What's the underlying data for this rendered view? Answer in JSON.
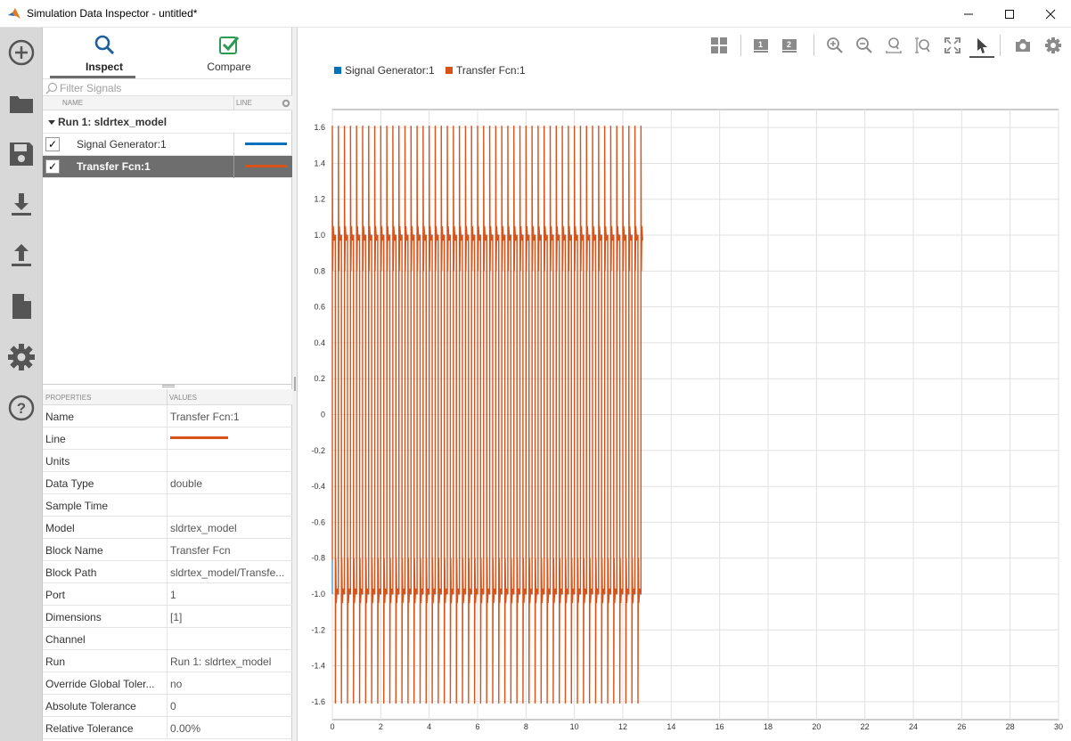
{
  "window": {
    "title": "Simulation Data Inspector - untitled*",
    "minimize": "—",
    "maximize": "☐",
    "close": "✕"
  },
  "rail": {
    "items": [
      "new-session",
      "open-folder",
      "save",
      "import",
      "export",
      "report",
      "settings",
      "help"
    ]
  },
  "tabs": {
    "inspect": "Inspect",
    "compare": "Compare"
  },
  "filter": {
    "placeholder": "Filter Signals"
  },
  "columns": {
    "name": "NAME",
    "line": "LINE"
  },
  "run": {
    "label": "Run 1: sldrtex_model"
  },
  "signals": [
    {
      "name": "Signal Generator:1",
      "checked": "✓",
      "color": "#0072bd",
      "selected": false
    },
    {
      "name": "Transfer Fcn:1",
      "checked": "✓",
      "color": "#d95319",
      "selected": true
    }
  ],
  "properties_header": {
    "key": "PROPERTIES",
    "value": "VALUES"
  },
  "properties": [
    {
      "key": "Name",
      "value": "Transfer Fcn:1"
    },
    {
      "key": "Line",
      "value": ""
    },
    {
      "key": "Units",
      "value": ""
    },
    {
      "key": "Data Type",
      "value": "double"
    },
    {
      "key": "Sample Time",
      "value": ""
    },
    {
      "key": "Model",
      "value": "sldrtex_model"
    },
    {
      "key": "Block Name",
      "value": "Transfer Fcn"
    },
    {
      "key": "Block Path",
      "value": "sldrtex_model/Transfe..."
    },
    {
      "key": "Port",
      "value": "1"
    },
    {
      "key": "Dimensions",
      "value": "[1]"
    },
    {
      "key": "Channel",
      "value": ""
    },
    {
      "key": "Run",
      "value": "Run 1: sldrtex_model"
    },
    {
      "key": "Override Global Toler...",
      "value": "no"
    },
    {
      "key": "Absolute Tolerance",
      "value": "0"
    },
    {
      "key": "Relative Tolerance",
      "value": "0.00%"
    }
  ],
  "toolbar": {
    "subplot_1": "1",
    "subplot_2": "2"
  },
  "colors": {
    "signal_generator": "#0072bd",
    "transfer_fcn": "#d95319",
    "selected_row": "#6e6e6e",
    "rail": "#d8d8d8"
  },
  "chart_data": {
    "type": "line",
    "title": "",
    "xlabel": "",
    "ylabel": "",
    "xlim": [
      0,
      30
    ],
    "ylim": [
      -1.7,
      1.7
    ],
    "grid": true,
    "legend_position": "top-left",
    "x_ticks": [
      0,
      2,
      4,
      6,
      8,
      10,
      12,
      14,
      16,
      18,
      20,
      22,
      24,
      26,
      28,
      30
    ],
    "y_ticks": [
      1.6,
      1.4,
      1.2,
      1.0,
      0.8,
      0.6,
      0.4,
      0.2,
      0,
      -0.2,
      -0.4,
      -0.6,
      -0.8,
      -1.0,
      -1.2,
      -1.4,
      -1.6
    ],
    "x_tick_labels": [
      "0",
      "2",
      "4",
      "6",
      "8",
      "10",
      "12",
      "14",
      "16",
      "18",
      "20",
      "22",
      "24",
      "26",
      "28",
      "30"
    ],
    "y_tick_labels": [
      "1.6",
      "1.4",
      "1.2",
      "1.0",
      "0.8",
      "0.6",
      "0.4",
      "0.2",
      "0",
      "-0.2",
      "-0.4",
      "-0.6",
      "-0.8",
      "-1.0",
      "-1.2",
      "-1.4",
      "-1.6"
    ],
    "series": [
      {
        "name": "Signal Generator:1",
        "color": "#0072bd",
        "waveform": "square",
        "amplitude": 1.0,
        "period": 0.25,
        "t_end": 12.8
      },
      {
        "name": "Transfer Fcn:1",
        "color": "#d95319",
        "waveform": "square-with-overshoot",
        "amplitude": 1.0,
        "overshoot_peak": 1.61,
        "settle_level": 0.81,
        "period": 0.25,
        "t_end": 12.8
      }
    ]
  }
}
